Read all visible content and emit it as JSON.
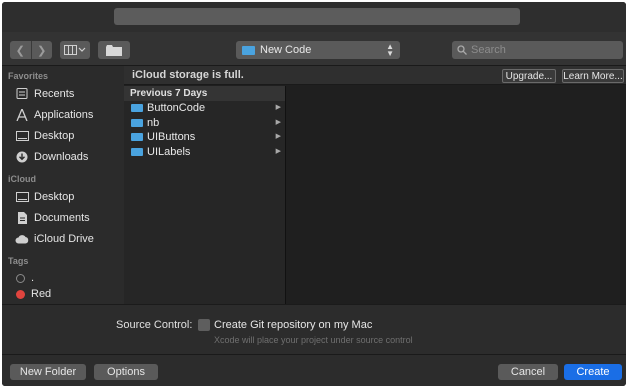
{
  "toolbar": {
    "location": "New Code",
    "search_placeholder": "Search"
  },
  "sidebar": {
    "favorites_title": "Favorites",
    "favorites": [
      {
        "label": "Recents",
        "icon": "clock-icon"
      },
      {
        "label": "Applications",
        "icon": "applications-icon"
      },
      {
        "label": "Desktop",
        "icon": "desktop-icon"
      },
      {
        "label": "Downloads",
        "icon": "downloads-icon"
      }
    ],
    "icloud_title": "iCloud",
    "icloud": [
      {
        "label": "Desktop",
        "icon": "desktop-icon"
      },
      {
        "label": "Documents",
        "icon": "documents-icon"
      },
      {
        "label": "iCloud Drive",
        "icon": "cloud-icon"
      }
    ],
    "tags_title": "Tags",
    "tags": [
      {
        "label": ".",
        "color": "#555555"
      },
      {
        "label": "Red",
        "color": "#e0443e"
      }
    ]
  },
  "banner": {
    "text": "iCloud storage is full.",
    "upgrade": "Upgrade...",
    "learn_more": "Learn More..."
  },
  "browser": {
    "header": "Previous 7 Days",
    "items": [
      "ButtonCode",
      "nb",
      "UIButtons",
      "UILabels"
    ]
  },
  "options": {
    "source_control_label": "Source Control:",
    "checkbox_label": "Create Git repository on my Mac",
    "hint": "Xcode will place your project under source control"
  },
  "footer": {
    "new_folder": "New Folder",
    "options": "Options",
    "cancel": "Cancel",
    "create": "Create"
  },
  "colors": {
    "accent": "#1a6ee6",
    "folder": "#4aa3df"
  }
}
